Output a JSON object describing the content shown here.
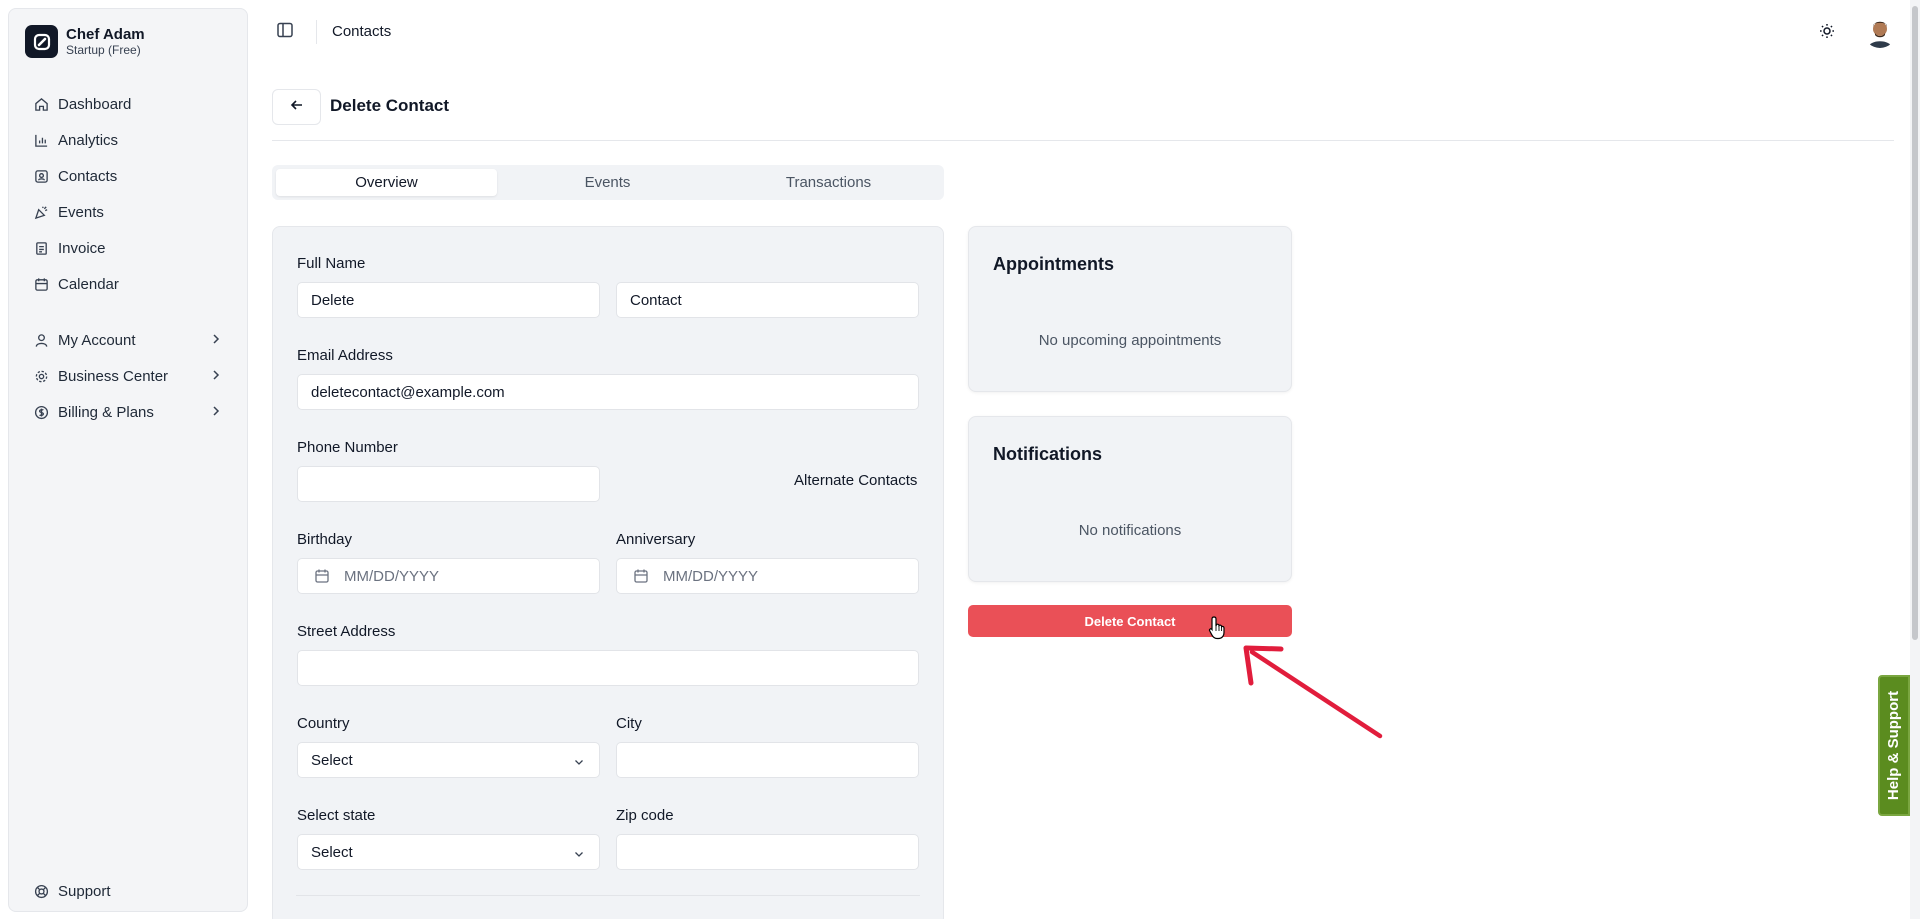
{
  "sidebar": {
    "user_name": "Chef Adam",
    "plan": "Startup (Free)",
    "items": [
      {
        "label": "Dashboard",
        "icon": "home-icon"
      },
      {
        "label": "Analytics",
        "icon": "bar-chart-icon"
      },
      {
        "label": "Contacts",
        "icon": "contacts-icon"
      },
      {
        "label": "Events",
        "icon": "party-popper-icon"
      },
      {
        "label": "Invoice",
        "icon": "document-icon"
      },
      {
        "label": "Calendar",
        "icon": "calendar-icon"
      }
    ],
    "groups": [
      {
        "label": "My Account",
        "icon": "user-icon"
      },
      {
        "label": "Business Center",
        "icon": "gear-icon"
      },
      {
        "label": "Billing & Plans",
        "icon": "dollar-circle-icon"
      }
    ],
    "support_label": "Support"
  },
  "topbar": {
    "breadcrumb": "Contacts"
  },
  "header": {
    "title": "Delete Contact"
  },
  "tabs": [
    {
      "label": "Overview",
      "active": true
    },
    {
      "label": "Events",
      "active": false
    },
    {
      "label": "Transactions",
      "active": false
    }
  ],
  "form": {
    "full_name_label": "Full Name",
    "first_name_value": "Delete",
    "last_name_value": "Contact",
    "email_label": "Email Address",
    "email_value": "deletecontact@example.com",
    "phone_label": "Phone Number",
    "phone_value": "",
    "alternate_contacts_label": "Alternate Contacts",
    "birthday_label": "Birthday",
    "birthday_placeholder": "MM/DD/YYYY",
    "anniversary_label": "Anniversary",
    "anniversary_placeholder": "MM/DD/YYYY",
    "street_label": "Street Address",
    "street_value": "",
    "country_label": "Country",
    "country_value": "Select",
    "city_label": "City",
    "city_value": "",
    "state_label": "Select state",
    "state_value": "Select",
    "zip_label": "Zip code",
    "zip_value": ""
  },
  "appointments": {
    "title": "Appointments",
    "empty_text": "No upcoming appointments"
  },
  "notifications": {
    "title": "Notifications",
    "empty_text": "No notifications"
  },
  "delete_button_label": "Delete Contact",
  "help_tab_label": "Help & Support",
  "colors": {
    "danger": "#ea5057",
    "annotation_arrow": "#e11d3c",
    "help_tab": "#5b8c1f"
  }
}
